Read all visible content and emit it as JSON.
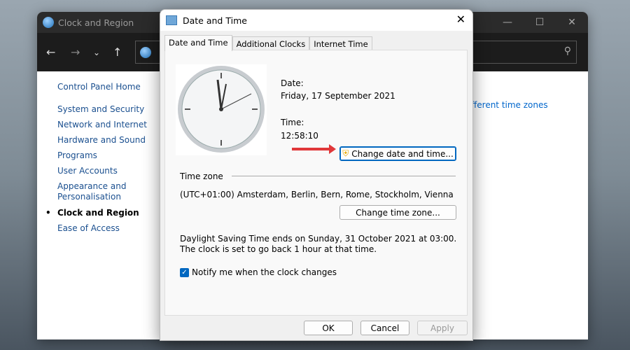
{
  "background_window": {
    "title": "Clock and Region",
    "sidebar": [
      "Control Panel Home",
      "System and Security",
      "Network and Internet",
      "Hardware and Sound",
      "Programs",
      "User Accounts",
      "Appearance and Personalisation",
      "Clock and Region",
      "Ease of Access"
    ],
    "current_item": "Clock and Region",
    "link_fragment": "fferent time zones"
  },
  "dialog": {
    "title": "Date and Time",
    "tabs": [
      "Date and Time",
      "Additional Clocks",
      "Internet Time"
    ],
    "active_tab": "Date and Time",
    "date_label": "Date:",
    "date_value": "Friday, 17 September 2021",
    "time_label": "Time:",
    "time_value": "12:58:10",
    "change_datetime_button": "Change date and time...",
    "timezone_heading": "Time zone",
    "timezone_value": "(UTC+01:00) Amsterdam, Berlin, Bern, Rome, Stockholm, Vienna",
    "change_timezone_button": "Change time zone...",
    "dst_text": "Daylight Saving Time ends on Sunday, 31 October 2021 at 03:00. The clock is set to go back 1 hour at that time.",
    "notify_label": "Notify me when the clock changes",
    "notify_checked": true,
    "ok": "OK",
    "cancel": "Cancel",
    "apply": "Apply"
  },
  "colors": {
    "accent": "#0067c0",
    "arrow": "#e0383a"
  }
}
